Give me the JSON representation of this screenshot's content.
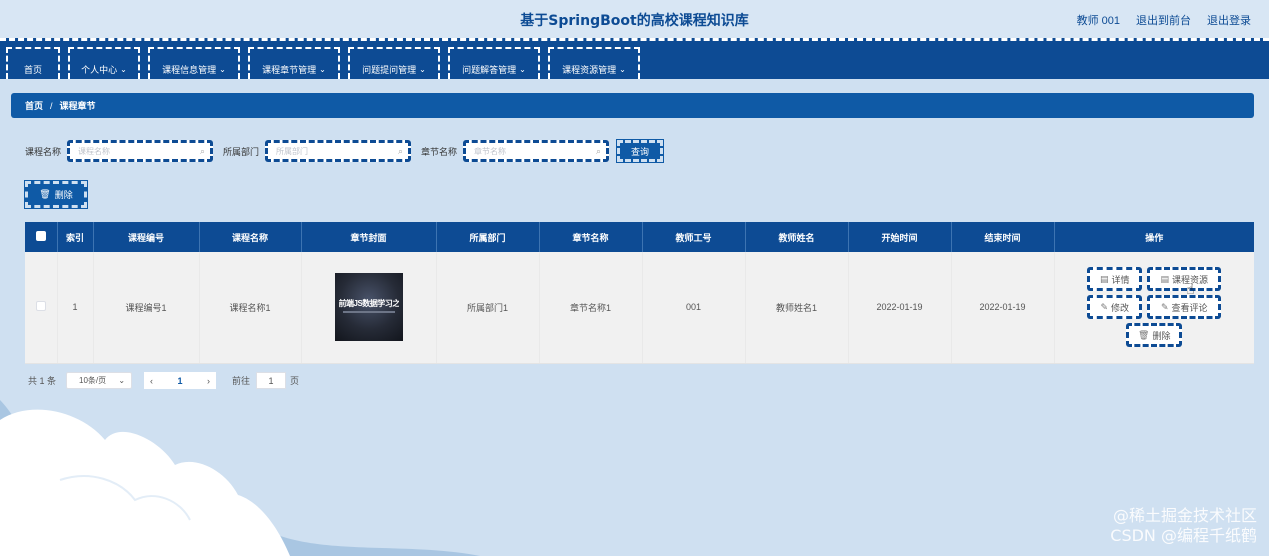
{
  "header": {
    "title": "基于SpringBoot的高校课程知识库",
    "links": [
      "教师 001",
      "退出到前台",
      "退出登录"
    ]
  },
  "nav": {
    "items": [
      {
        "label": "首页",
        "dropdown": false
      },
      {
        "label": "个人中心",
        "dropdown": true
      },
      {
        "label": "课程信息管理",
        "dropdown": true
      },
      {
        "label": "课程章节管理",
        "dropdown": true
      },
      {
        "label": "问题提问管理",
        "dropdown": true
      },
      {
        "label": "问题解答管理",
        "dropdown": true
      },
      {
        "label": "课程资源管理",
        "dropdown": true
      }
    ]
  },
  "breadcrumb": {
    "home": "首页",
    "separator": "/",
    "current": "课程章节"
  },
  "search": {
    "fields": [
      {
        "label": "课程名称",
        "placeholder": "课程名称",
        "value": ""
      },
      {
        "label": "所属部门",
        "placeholder": "所属部门",
        "value": ""
      },
      {
        "label": "章节名称",
        "placeholder": "章节名称",
        "value": ""
      }
    ],
    "query_label": "查询",
    "delete_label": "删除"
  },
  "table": {
    "columns": [
      "索引",
      "课程编号",
      "课程名称",
      "章节封面",
      "所属部门",
      "章节名称",
      "教师工号",
      "教师姓名",
      "开始时间",
      "结束时间",
      "操作"
    ],
    "rows": [
      {
        "index": "1",
        "course_no": "课程编号1",
        "course_name": "课程名称1",
        "cover_text": "前端JS数据学习之路",
        "department": "所属部门1",
        "chapter_name": "章节名称1",
        "teacher_no": "001",
        "teacher_name": "教师姓名1",
        "start": "2022-01-19",
        "end": "2022-01-19"
      }
    ],
    "actions": {
      "detail": "详情",
      "resource": "课程资源",
      "edit": "修改",
      "comments": "查看评论",
      "delete": "删除"
    }
  },
  "pager": {
    "total": "共 1 条",
    "page_size": "10条/页",
    "current_page": "1",
    "goto_label": "前往",
    "goto_value": "1",
    "page_suffix": "页"
  },
  "watermark": [
    "@稀土掘金技术社区",
    "CSDN @编程千纸鹤"
  ],
  "colors": {
    "primary": "#0d4b94",
    "accent": "#0f5aa6",
    "background": "#cfe0f1"
  }
}
